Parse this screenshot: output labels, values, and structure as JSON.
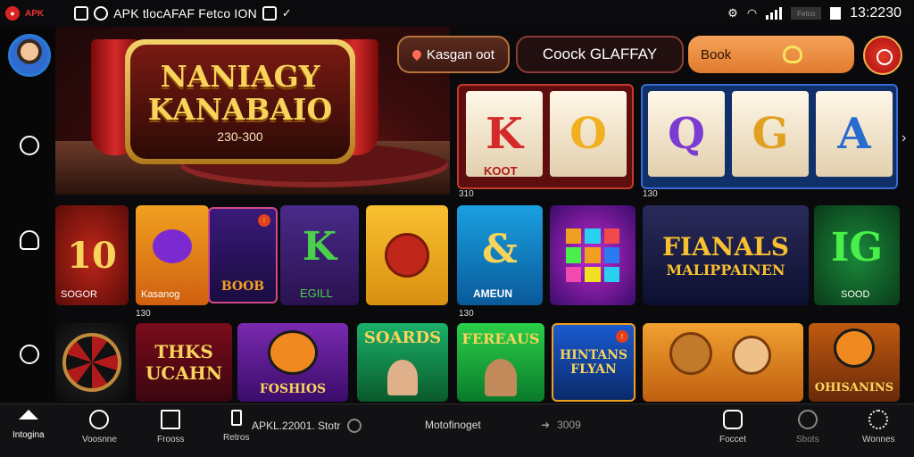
{
  "status_bar": {
    "brand": "APK",
    "notif_text": "APK tlocAFAF Fetco ION",
    "time": "13:2230",
    "pill": "Fetco"
  },
  "hero": {
    "title_line1": "NANIAGY",
    "title_line2": "KANABAIO",
    "number": "230-300"
  },
  "header": {
    "location_label": "Kasgan oot",
    "clock_label": "Coock GLAFFAY",
    "book_label": "Book"
  },
  "row1": {
    "tile1": {
      "reels": [
        "K",
        "O"
      ],
      "sub": "KOOT",
      "caption": "310"
    },
    "tile2": {
      "reels": [
        "Q",
        "G",
        "A"
      ],
      "caption": "130"
    }
  },
  "row2": {
    "tiles": [
      {
        "label": "10",
        "caption": "SOGOR"
      },
      {
        "label": "Kasanog",
        "caption": "130"
      },
      {
        "label": "BOOB",
        "caption": ""
      },
      {
        "label": "K",
        "caption": "EGILL"
      },
      {
        "label": "",
        "caption": ""
      },
      {
        "label": "&",
        "caption": "AMEUN"
      },
      {
        "label": "",
        "caption": ""
      },
      {
        "label": "FIANALS",
        "caption": "MALIPPAINEN"
      },
      {
        "label": "IG",
        "caption": "SOOD"
      }
    ],
    "row_caption_left": "130",
    "row_caption_mid": "130"
  },
  "row3": {
    "tiles": [
      {
        "label": "",
        "caption": ""
      },
      {
        "label": "THKS",
        "caption": "UCAHN"
      },
      {
        "label": "FOSHIOS",
        "caption": ""
      },
      {
        "label": "SOARDS",
        "caption": ""
      },
      {
        "label": "FEREAUS",
        "caption": ""
      },
      {
        "label": "HINTANS",
        "caption": "FLYAN"
      },
      {
        "label": "",
        "caption": ""
      },
      {
        "label": "OHISANINS",
        "caption": ""
      }
    ]
  },
  "tabbar": {
    "tabs": [
      {
        "label": "Intogina"
      },
      {
        "label": "Voosnne"
      },
      {
        "label": "Frooss"
      },
      {
        "label": "Foccet"
      },
      {
        "label": "Sbots"
      },
      {
        "label": "Wonnes"
      }
    ],
    "retro": "Retros",
    "apk_text": "APKL.22001. Stotr",
    "mid_text": "Motofinoget",
    "right_text": "3009"
  },
  "colors": {
    "accent_orange": "#e07b2e",
    "accent_red": "#d42a2a",
    "gold": "#f8d45a"
  }
}
